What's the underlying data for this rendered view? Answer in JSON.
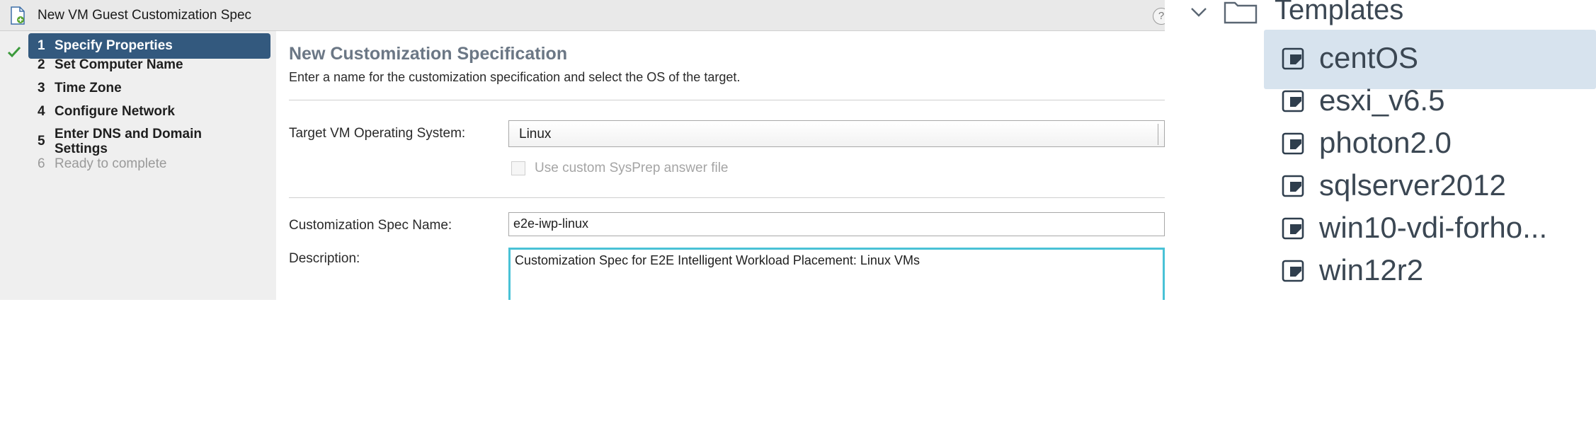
{
  "wizard": {
    "title": "New VM Guest Customization Spec",
    "help": "?",
    "steps": [
      {
        "num": "1",
        "label": "Specify Properties"
      },
      {
        "num": "2",
        "label": "Set Computer Name"
      },
      {
        "num": "3",
        "label": "Time Zone"
      },
      {
        "num": "4",
        "label": "Configure Network"
      },
      {
        "num": "5",
        "label": "Enter DNS and Domain Settings",
        "line1": "Enter DNS and Domain",
        "line2": "Settings"
      },
      {
        "num": "6",
        "label": "Ready to complete"
      }
    ],
    "heading": "New Customization Specification",
    "subheading": "Enter a name for the customization specification and select the OS of the target.",
    "os_label": "Target VM Operating System:",
    "os_value": "Linux",
    "sysprep_label": "Use custom SysPrep answer file",
    "spec_name_label": "Customization Spec Name:",
    "spec_name_value": "e2e-iwp-linux",
    "description_label": "Description:",
    "description_value": "Customization Spec for E2E Intelligent Workload Placement: Linux VMs"
  },
  "tree": {
    "folder": "Templates",
    "items": [
      "centOS",
      "esxi_v6.5",
      "photon2.0",
      "sqlserver2012",
      "win10-vdi-forho...",
      "win12r2"
    ],
    "selected": "centOS"
  },
  "colors": {
    "active_step_bg": "#33597e",
    "selection_bg": "#d7e3ee",
    "focus_border": "#49c2d6",
    "check_green": "#3c9a3c"
  }
}
